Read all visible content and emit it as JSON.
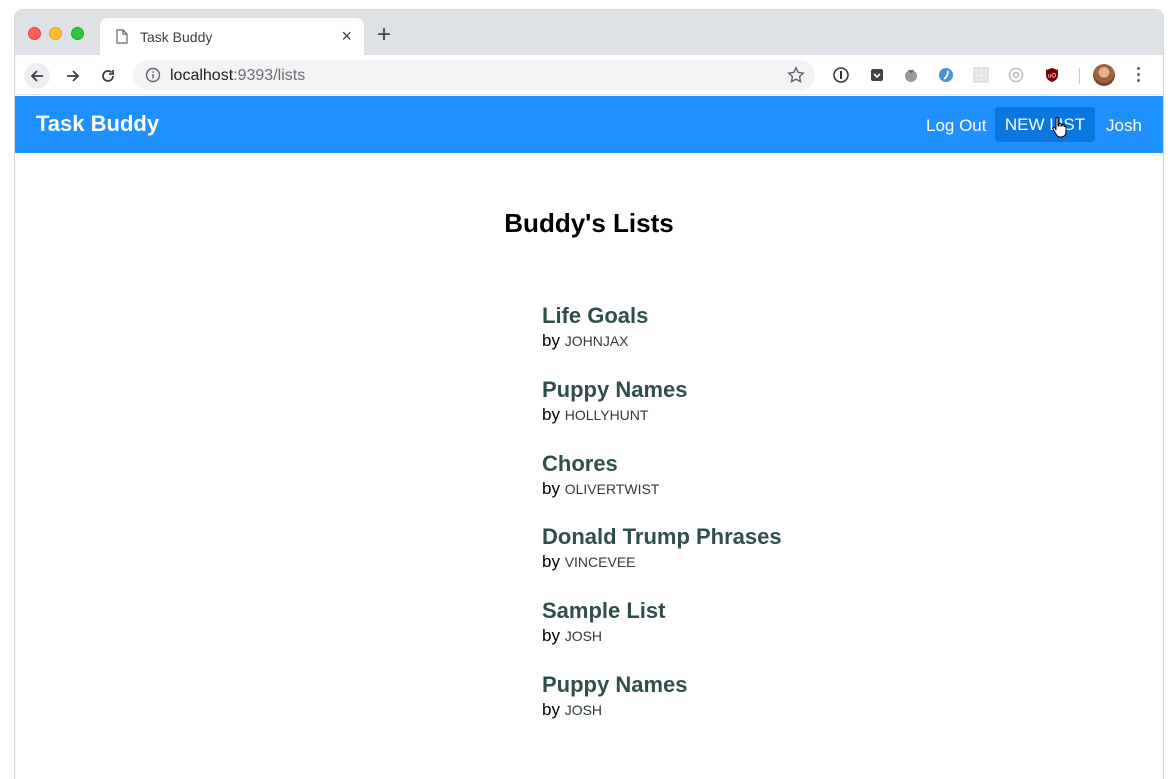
{
  "browser": {
    "tab_title": "Task Buddy",
    "new_tab_symbol": "+",
    "tab_close_symbol": "×",
    "url_host": "localhost",
    "url_path": ":9393/lists"
  },
  "app": {
    "brand": "Task Buddy",
    "nav": {
      "logout": "Log Out",
      "new_list": "NEW LIST",
      "user": "Josh"
    },
    "accent_color": "#1e90ff"
  },
  "page": {
    "title": "Buddy's Lists",
    "by_label": "by",
    "lists": [
      {
        "name": "Life Goals",
        "author": "JOHNJAX"
      },
      {
        "name": "Puppy Names",
        "author": "HOLLYHUNT"
      },
      {
        "name": "Chores",
        "author": "OLIVERTWIST"
      },
      {
        "name": "Donald Trump Phrases",
        "author": "VINCEVEE"
      },
      {
        "name": "Sample List",
        "author": "JOSH"
      },
      {
        "name": "Puppy Names",
        "author": "JOSH"
      }
    ]
  }
}
